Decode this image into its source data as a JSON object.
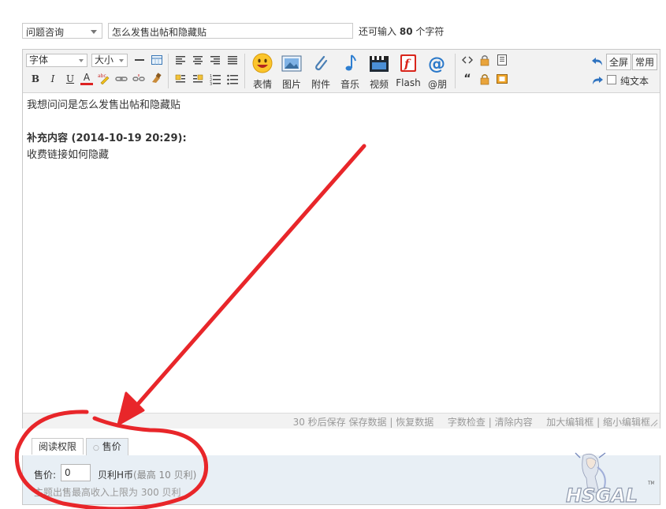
{
  "header": {
    "category_select": "问题咨询",
    "subject_value": "怎么发售出帖和隐藏贴",
    "counter": {
      "prefix": "还可输入",
      "count": "80",
      "suffix": "个字符"
    }
  },
  "toolbar": {
    "font_select": "字体",
    "size_select": "大小",
    "format_buttons": [
      "B",
      "I",
      "U",
      "A"
    ],
    "big_buttons": [
      "表情",
      "图片",
      "附件",
      "音乐",
      "视频",
      "Flash",
      "@朋"
    ],
    "fullscreen": "全屏",
    "common": "常用",
    "plaintext": "纯文本"
  },
  "content": {
    "line1": "我想问问是怎么发售出帖和隐藏贴",
    "supplement_header": "补充内容 (2014-10-19 20:29):",
    "line2": "收费链接如何隐藏"
  },
  "statusbar": {
    "autosave": "30 秒后保存",
    "save": "保存数据",
    "restore": "恢复数据",
    "wordcount": "字数检查",
    "clear": "清除内容",
    "enlarge": "加大编辑框",
    "shrink": "缩小编辑框",
    "sep": "|"
  },
  "tabs": {
    "read_perm": "阅读权限",
    "sell": "售价",
    "sell_bullet": "○"
  },
  "sell_panel": {
    "price_label": "售价:",
    "price_value": "0",
    "unit": "贝利H币",
    "max_note": "(最高 10 贝利)",
    "hint": "主题出售最高收入上限为 300 贝利"
  },
  "colors": {
    "toolbar_bg": "#f2f2f2",
    "panel_bg": "#e8eff5",
    "annotation_red": "#e8262a"
  }
}
